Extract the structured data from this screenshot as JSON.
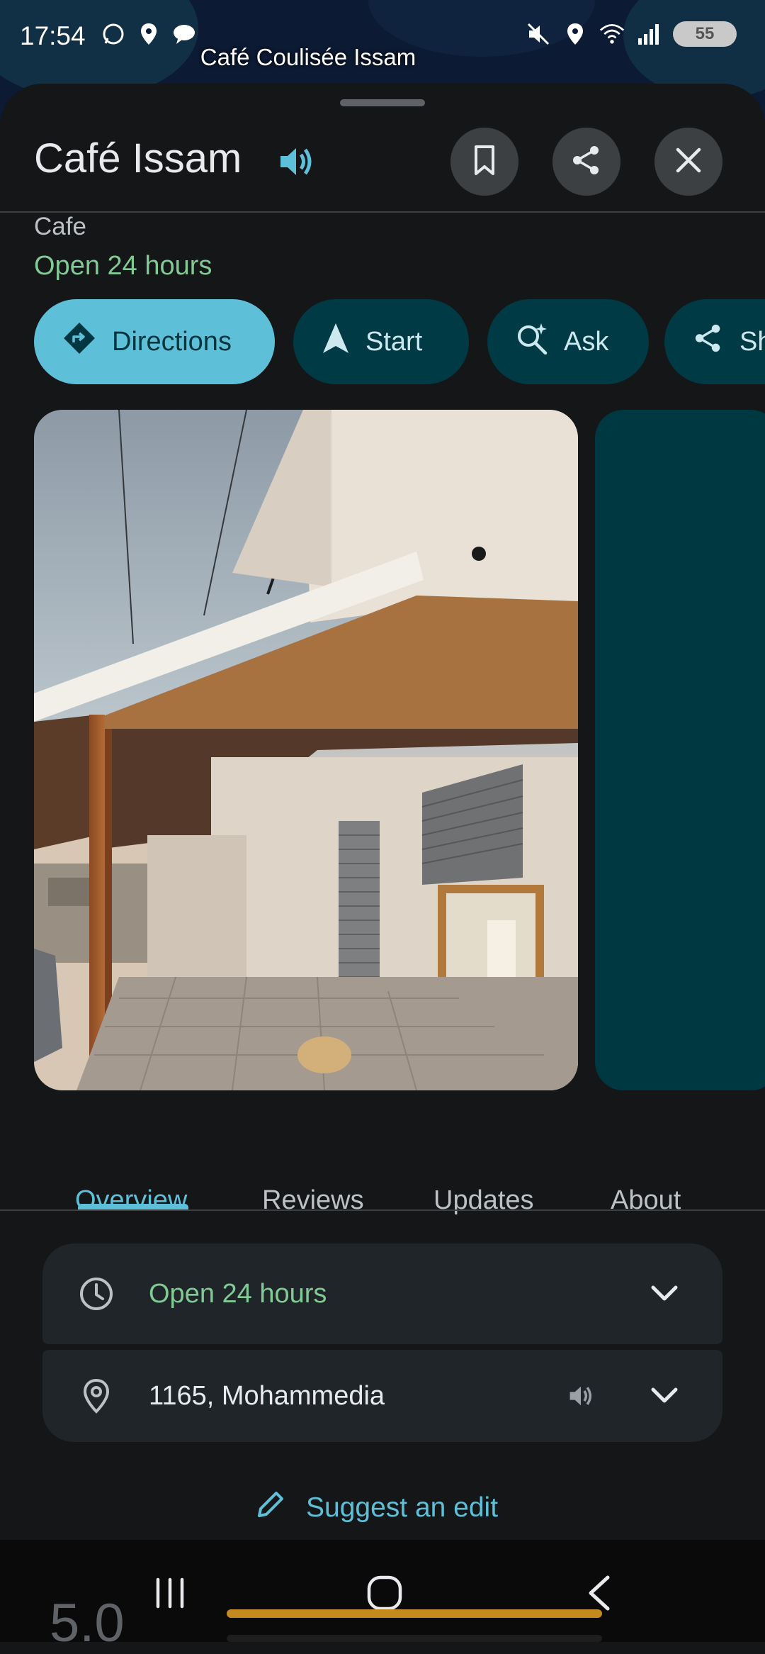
{
  "status_bar": {
    "time": "17:54",
    "battery": "55",
    "left_icons": [
      "whatsapp-icon",
      "location-icon",
      "chat-bubble-icon"
    ],
    "right_icons": [
      "mute-icon",
      "location-icon",
      "wifi-icon",
      "signal-icon"
    ]
  },
  "map": {
    "label": "Café Coulisée Issam"
  },
  "place": {
    "name": "Café Issam",
    "category": "Cafe",
    "hours_status": "Open 24 hours"
  },
  "actions": {
    "directions": "Directions",
    "start": "Start",
    "ask": "Ask",
    "share": "Share"
  },
  "tabs": [
    "Overview",
    "Reviews",
    "Updates",
    "About"
  ],
  "overview": {
    "hours": "Open 24 hours",
    "address": "1165, Mohammedia"
  },
  "suggest_edit": "Suggest an edit",
  "rating_peek": "5.0",
  "colors": {
    "accent": "#5ec0d8",
    "open_green": "#81c995",
    "chip_bg": "#003a44",
    "sheet_bg": "#141618",
    "card_bg": "#1f2528"
  }
}
